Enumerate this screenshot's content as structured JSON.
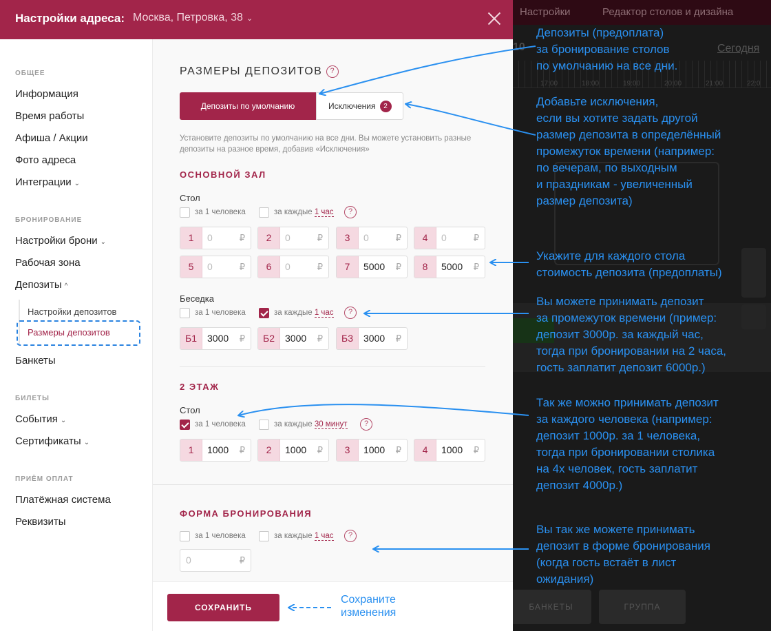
{
  "background_app": {
    "top_item_settings": "Настройки",
    "top_item_editor": "Редактор столов и дизайна",
    "time_fragment": "10",
    "today_link": "Сегодня",
    "ticks": [
      "17:00",
      "18:00",
      "19:00",
      "20:00",
      "21:00",
      "22:0"
    ],
    "btn_banquets": "БАНКЕТЫ",
    "btn_group": "ГРУППА"
  },
  "header": {
    "title": "Настройки адреса:",
    "address": "Москва, Петровка, 38"
  },
  "sidebar": {
    "section_general": "ОБЩЕЕ",
    "info": "Информация",
    "hours": "Время работы",
    "promo": "Афиша / Акции",
    "photo": "Фото адреса",
    "integrations": "Интеграции",
    "section_booking": "БРОНИРОВАНИЕ",
    "booking_settings": "Настройки брони",
    "work_zone": "Рабочая зона",
    "deposits": "Депозиты",
    "deposit_settings": "Настройки депозитов",
    "deposit_sizes": "Размеры депозитов",
    "banquets": "Банкеты",
    "section_tickets": "БИЛЕТЫ",
    "events": "События",
    "certificates": "Сертификаты",
    "section_payments": "ПРИЁМ ОПЛАТ",
    "payment_system": "Платёжная система",
    "requisites": "Реквизиты"
  },
  "main": {
    "title": "РАЗМЕРЫ ДЕПОЗИТОВ",
    "help": "?",
    "tab_default": "Депозиты по умолчанию",
    "tab_exceptions": "Исключения",
    "exceptions_count": "2",
    "description": "Установите депозиты по умолчанию на все дни. Вы можете установить разные депозиты на разное время, добавив «Исключения»",
    "opt_per_person": "за 1 человека",
    "opt_every": "за каждые",
    "currency": "₽",
    "sections": [
      {
        "title": "ОСНОВНОЙ ЗАЛ",
        "groups": [
          {
            "label": "Стол",
            "per_person_checked": false,
            "per_time_checked": false,
            "period": "1 час",
            "fields": [
              {
                "tag": "1",
                "value": "0",
                "empty": true
              },
              {
                "tag": "2",
                "value": "0",
                "empty": true
              },
              {
                "tag": "3",
                "value": "0",
                "empty": true
              },
              {
                "tag": "4",
                "value": "0",
                "empty": true
              },
              {
                "tag": "5",
                "value": "0",
                "empty": true
              },
              {
                "tag": "6",
                "value": "0",
                "empty": true
              },
              {
                "tag": "7",
                "value": "5000",
                "empty": false
              },
              {
                "tag": "8",
                "value": "5000",
                "empty": false
              }
            ]
          },
          {
            "label": "Беседка",
            "per_person_checked": false,
            "per_time_checked": true,
            "period": "1 час",
            "fields": [
              {
                "tag": "Б1",
                "value": "3000",
                "empty": false
              },
              {
                "tag": "Б2",
                "value": "3000",
                "empty": false
              },
              {
                "tag": "Б3",
                "value": "3000",
                "empty": false
              }
            ]
          }
        ]
      },
      {
        "title": "2 ЭТАЖ",
        "groups": [
          {
            "label": "Стол",
            "per_person_checked": true,
            "per_time_checked": false,
            "period": "30 минут",
            "fields": [
              {
                "tag": "1",
                "value": "1000",
                "empty": false
              },
              {
                "tag": "2",
                "value": "1000",
                "empty": false
              },
              {
                "tag": "3",
                "value": "1000",
                "empty": false
              },
              {
                "tag": "4",
                "value": "1000",
                "empty": false
              }
            ]
          }
        ]
      },
      {
        "title": "ФОРМА БРОНИРОВАНИЯ",
        "groups": [
          {
            "label": "",
            "per_person_checked": false,
            "per_time_checked": false,
            "period": "1 час",
            "fields": [
              {
                "tag": "",
                "value": "0",
                "empty": true
              }
            ]
          }
        ]
      }
    ],
    "save": "СОХРАНИТЬ"
  },
  "annotations": {
    "n1": [
      "Депозиты (предоплата)",
      "за бронирование столов",
      "по умолчанию на все дни."
    ],
    "n2": [
      "Добавьте исключения,",
      "если вы хотите задать другой",
      "размер депозита в определённый",
      "промежуток времени (например:",
      "по вечерам, по выходным",
      "и праздникам - увеличенный",
      "размер депозита)"
    ],
    "n3": [
      "Укажите для каждого стола",
      "стоимость депозита (предоплаты)"
    ],
    "n4": [
      "Вы можете принимать депозит",
      "за промежуток времени (пример:",
      "депозит 3000р. за каждый час,",
      "тогда при бронировании на 2 часа,",
      "гость заплатит депозит 6000р.)"
    ],
    "n5": [
      "Так же можно принимать депозит",
      "за каждого человека (например:",
      "депозит 1000р. за 1 человека,",
      "тогда при бронировании столика",
      "на 4х человек, гость заплатит",
      "депозит 4000р.)"
    ],
    "n6": [
      "Вы так же можете принимать",
      "депозит в форме бронирования",
      "(когда гость встаёт в лист",
      "ожидания)"
    ],
    "n7": [
      "Сохраните",
      "изменения"
    ]
  },
  "colors": {
    "brand": "#a2254a",
    "annotation": "#2a90f0",
    "tag_bg": "#f5d9e1"
  }
}
